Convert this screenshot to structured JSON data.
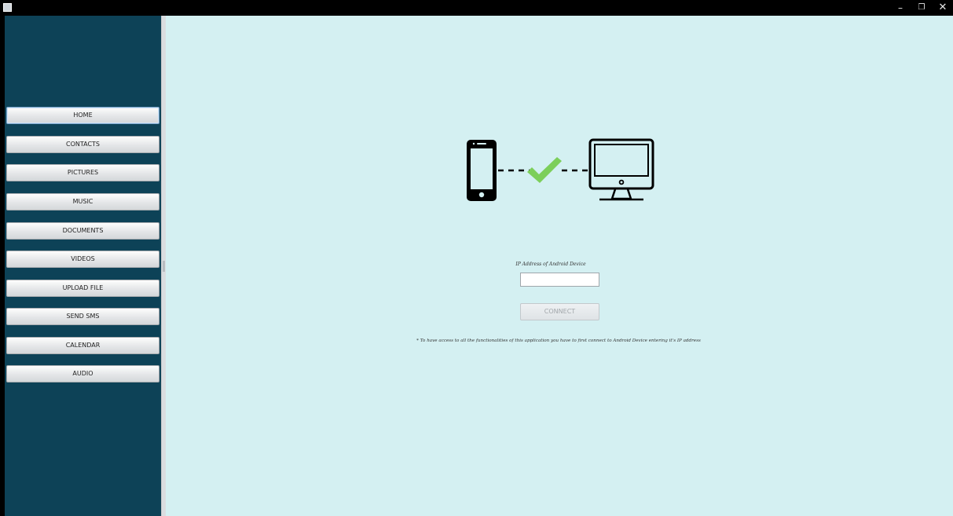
{
  "window": {
    "controls": {
      "minimize": "–",
      "maximize": "❐",
      "close": "✕"
    }
  },
  "sidebar": {
    "items": [
      {
        "label": "HOME"
      },
      {
        "label": "CONTACTS"
      },
      {
        "label": "PICTURES"
      },
      {
        "label": "MUSIC"
      },
      {
        "label": "DOCUMENTS"
      },
      {
        "label": "VIDEOS"
      },
      {
        "label": "UPLOAD FILE"
      },
      {
        "label": "SEND SMS"
      },
      {
        "label": "CALENDAR"
      },
      {
        "label": "AUDIO"
      }
    ],
    "active": "HOME"
  },
  "main": {
    "illustration_icons": [
      "phone-icon",
      "check-icon",
      "monitor-icon"
    ],
    "ip_label": "IP Address of Android Device",
    "ip_value": "",
    "connect_label": "CONNECT",
    "note": "* To have access to all the functionalities of this application you have to first connect to Android Device entering it's IP address"
  },
  "colors": {
    "sidebar_bg": "#0d4257",
    "main_bg": "#d4f0f2",
    "check": "#7ccf5a",
    "titlebar": "#000000"
  }
}
